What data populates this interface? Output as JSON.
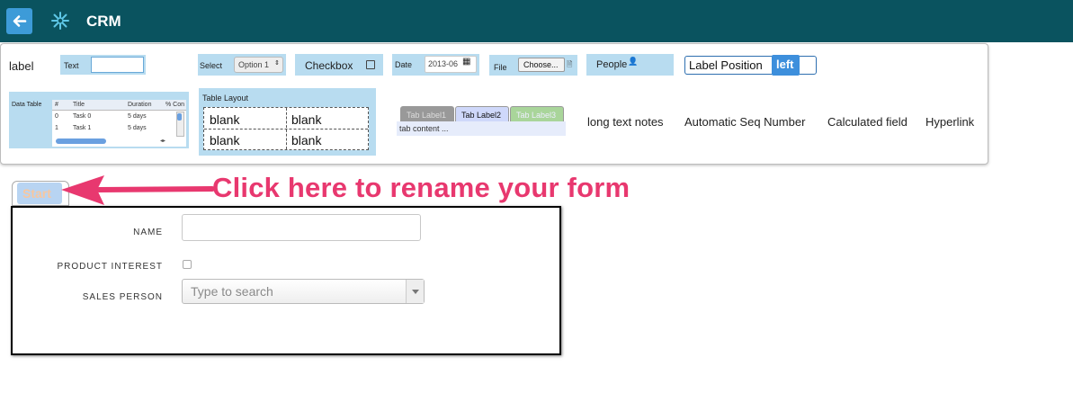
{
  "app": {
    "title": "CRM"
  },
  "colors": {
    "topbar": "#0a535f",
    "accent": "#3d8fdc",
    "callout": "#e8386f",
    "widget": "#b8dcf0"
  },
  "icons": {
    "back": "arrow-left-icon",
    "app": "asterisk-icon"
  },
  "palette": {
    "label": "label",
    "text": {
      "label": "Text"
    },
    "select": {
      "label": "Select",
      "value": "Option 1"
    },
    "checkbox": {
      "label": "Checkbox"
    },
    "date": {
      "label": "Date",
      "value": "2013-06"
    },
    "file": {
      "label": "File",
      "button": "Choose..."
    },
    "people": {
      "label": "People"
    },
    "label_position": {
      "label": "Label Position",
      "value": "left"
    },
    "data_table": {
      "label": "Data Table",
      "columns": [
        "#",
        "Title",
        "Duration",
        "% Con"
      ],
      "rows": [
        [
          "0",
          "Task 0",
          "5 days"
        ],
        [
          "1",
          "Task 1",
          "5 days"
        ]
      ]
    },
    "table_layout": {
      "label": "Table Layout",
      "cells": [
        "blank",
        "blank",
        "blank",
        "blank"
      ]
    },
    "tabs": {
      "labels": [
        "Tab Label1",
        "Tab Label2",
        "Tab Label3"
      ],
      "content": "tab content ..."
    },
    "long_text": "long text notes",
    "auto_seq": "Automatic Seq Number",
    "calculated": "Calculated field",
    "hyperlink": "Hyperlink"
  },
  "form": {
    "tab_label": "Start",
    "fields": [
      {
        "label": "NAME"
      },
      {
        "label": "PRODUCT INTEREST"
      },
      {
        "label": "SALES PERSON",
        "placeholder": "Type to search"
      }
    ]
  },
  "annotation": {
    "text": "Click here to rename your form"
  }
}
